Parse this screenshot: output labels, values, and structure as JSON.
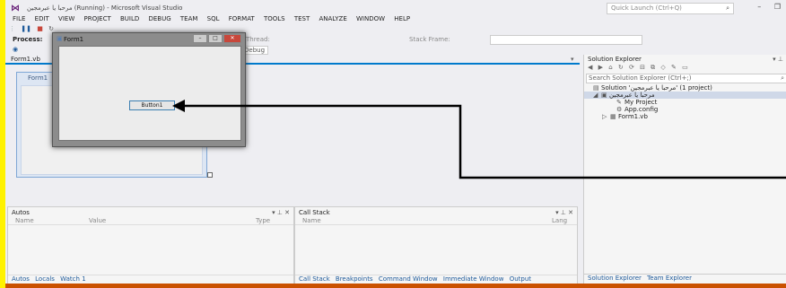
{
  "window": {
    "title": "مرحبا يا عبرمجين (Running) - Microsoft Visual Studio",
    "quick_launch_placeholder": "Quick Launch (Ctrl+Q)"
  },
  "menu": [
    "FILE",
    "EDIT",
    "VIEW",
    "PROJECT",
    "BUILD",
    "DEBUG",
    "TEAM",
    "SQL",
    "FORMAT",
    "TOOLS",
    "TEST",
    "ANALYZE",
    "WINDOW",
    "HELP"
  ],
  "toolbar": {
    "process_label": "Process:",
    "thread_label": "Thread:",
    "stack_frame_label": "Stack Frame:",
    "debug_select": "Debug"
  },
  "document_tab": "Form1.vb",
  "designer": {
    "form_title": "Form1"
  },
  "running_form": {
    "title": "Form1",
    "button_label": "Button1"
  },
  "solution_explorer": {
    "title": "Solution Explorer",
    "search_placeholder": "Search Solution Explorer (Ctrl+;)",
    "nodes": [
      {
        "label": "Solution 'مرحبا يا عبرمجين' (1 project)"
      },
      {
        "label": "مرحبا يا عبرمجين"
      },
      {
        "label": "My Project"
      },
      {
        "label": "App.config"
      },
      {
        "label": "Form1.vb"
      }
    ],
    "bottom_tabs": [
      "Solution Explorer",
      "Team Explorer"
    ]
  },
  "autos": {
    "title": "Autos",
    "columns": [
      "Name",
      "Value",
      "Type"
    ],
    "tabs": [
      "Autos",
      "Locals",
      "Watch 1"
    ]
  },
  "callstack": {
    "title": "Call Stack",
    "columns": [
      "Name",
      "Lang"
    ],
    "tabs": [
      "Call Stack",
      "Breakpoints",
      "Command Window",
      "Immediate Window",
      "Output"
    ]
  },
  "colors": {
    "background": "#fff200",
    "arrow": "#000000",
    "status_bar": "#ca5100",
    "accent": "#007acc"
  }
}
